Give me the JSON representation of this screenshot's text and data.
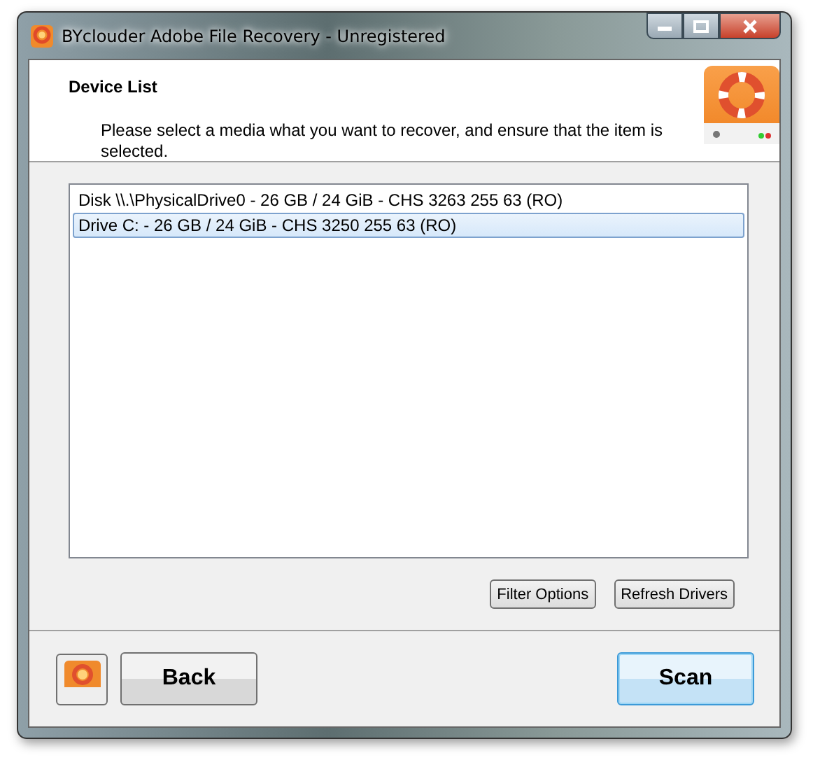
{
  "window": {
    "title": "BYclouder Adobe File Recovery - Unregistered"
  },
  "header": {
    "title": "Device List",
    "description": "Please select a media what you want to recover, and ensure that the item is selected."
  },
  "devices": [
    {
      "label": "Disk \\\\.\\PhysicalDrive0 - 26 GB / 24 GiB - CHS 3263 255 63 (RO)",
      "selected": false
    },
    {
      "label": "Drive C: - 26 GB / 24 GiB - CHS 3250 255 63 (RO)",
      "selected": true
    }
  ],
  "options_buttons": [
    "Filter Options",
    "Refresh Drivers"
  ],
  "back_button": "Back",
  "scan_button": "Scan"
}
